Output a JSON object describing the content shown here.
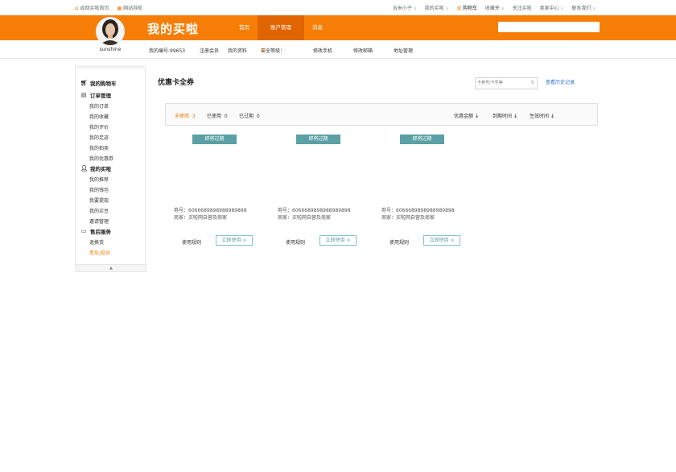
{
  "topbar": {
    "home_link": "返回买啦首页",
    "site_nav": "网站导航",
    "user": "吉米小子",
    "my_buy": "我的买啦",
    "cart": "购物车",
    "favorites": "收藏夹",
    "follow": "关注买啦",
    "seller_center": "卖家中心",
    "contact": "联系我们"
  },
  "header": {
    "logo": "我的买啦",
    "nav": [
      "首页",
      "账户管理",
      "消息"
    ],
    "active_nav": "账户管理",
    "search_value": ""
  },
  "profile": {
    "username": "sunshine"
  },
  "subbar": {
    "id_label": "我的编号:99653",
    "register": "注册会员",
    "my_info": "我的资料",
    "security_label": "安全等级：",
    "security_level": "中",
    "change_phone": "修改手机",
    "change_email": "修改邮箱",
    "address": "地址管理"
  },
  "sidebar": {
    "groups": [
      {
        "title": "我的购物车",
        "icon": "cart-icon",
        "items": []
      },
      {
        "title": "订单管理",
        "icon": "document-icon",
        "items": [
          "我的订单",
          "我的收藏",
          "我的评价",
          "我的足迹",
          "我的拍卖",
          "我的优惠券"
        ]
      },
      {
        "title": "我的买啦",
        "icon": "user-icon",
        "items": [
          "我的推荐",
          "我的钱包",
          "我要提现",
          "我的买豆",
          "邀请管理"
        ]
      },
      {
        "title": "售后服务",
        "icon": "card-icon",
        "items": [
          "退换货",
          "意见/投诉"
        ]
      }
    ],
    "active_item": "意见/投诉",
    "collapse_glyph": "▲"
  },
  "main": {
    "title": "优惠卡全券",
    "search_placeholder": "卡券号/卡号等",
    "history_link": "查看历史记录",
    "tabs": [
      {
        "label": "未使用",
        "count": "3"
      },
      {
        "label": "已使用",
        "count": "0"
      },
      {
        "label": "已过期",
        "count": "0"
      }
    ],
    "sorts": [
      "优惠金额",
      "到期时间",
      "生效时间"
    ],
    "sort_arrow": "🡓",
    "coupons": [
      {
        "badge": "即将过期",
        "number": "券号：6066689898988989898",
        "shop": "商家：买啦网自营及商家",
        "rule": "使用规则",
        "use": "立即使用 >"
      },
      {
        "badge": "即将过期",
        "number": "券号：6066689898988989898",
        "shop": "商家：买啦网自营及商家",
        "rule": "使用规则",
        "use": "立即使用 >"
      },
      {
        "badge": "即将过期",
        "number": "券号：6066689898988989898",
        "shop": "商家：买啦网自营及商家",
        "rule": "使用规则",
        "use": "立即使用 >"
      }
    ]
  },
  "colors": {
    "brand_orange": "#f77e06",
    "nav_active": "#e06500",
    "badge_teal": "#5ba0a5",
    "link_blue": "#2b6fc4"
  }
}
